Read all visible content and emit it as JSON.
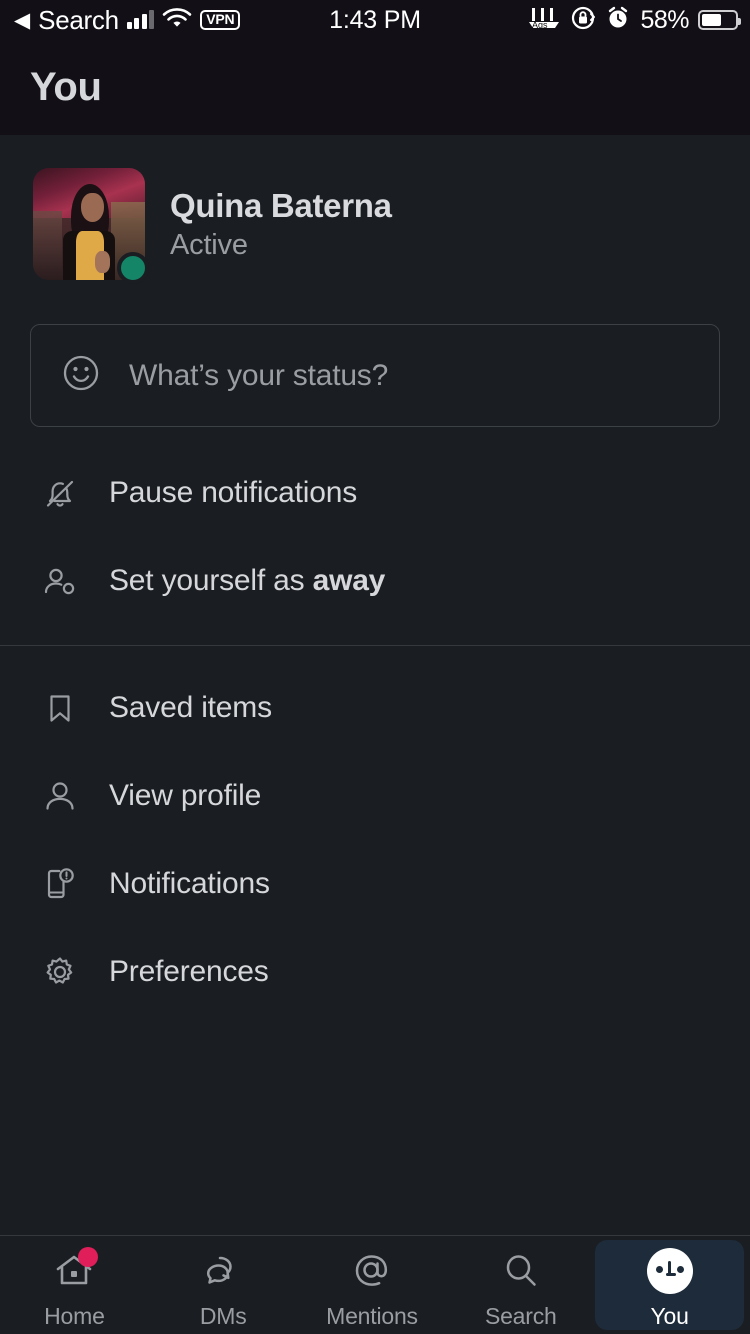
{
  "status_bar": {
    "back_label": "Search",
    "back_arrow": "◀",
    "vpn_label": "VPN",
    "time": "1:43 PM",
    "battery_percent": "58%",
    "icons": [
      "signal-bars-icon",
      "wifi-icon",
      "vpn-icon",
      "app-indicators-icon",
      "screen-lock-rotation-icon",
      "alarm-icon",
      "battery-icon"
    ]
  },
  "header": {
    "title": "You"
  },
  "profile": {
    "name": "Quina Baterna",
    "presence": "Active",
    "presence_color": "#148567",
    "avatar_name": "user-avatar"
  },
  "status_input": {
    "placeholder": "What’s your status?",
    "emoji_icon": "smiley-icon"
  },
  "menu_groups": [
    {
      "items": [
        {
          "icon": "bell-slash-icon",
          "label": "Pause notifications",
          "bold_suffix": ""
        },
        {
          "icon": "person-away-icon",
          "label": "Set yourself as ",
          "bold_suffix": "away"
        }
      ]
    },
    {
      "items": [
        {
          "icon": "bookmark-icon",
          "label": "Saved items",
          "bold_suffix": ""
        },
        {
          "icon": "person-icon",
          "label": "View profile",
          "bold_suffix": ""
        },
        {
          "icon": "phone-notification-icon",
          "label": "Notifications",
          "bold_suffix": ""
        },
        {
          "icon": "gear-icon",
          "label": "Preferences",
          "bold_suffix": ""
        }
      ]
    }
  ],
  "tab_bar": {
    "badge_color": "#e01e5a",
    "active_bg": "#1d2b3a",
    "tabs": [
      {
        "icon": "home-icon",
        "label": "Home",
        "badge": true,
        "active": false
      },
      {
        "icon": "speech-bubbles-icon",
        "label": "DMs",
        "badge": false,
        "active": false
      },
      {
        "icon": "at-sign-icon",
        "label": "Mentions",
        "badge": false,
        "active": false
      },
      {
        "icon": "magnifier-icon",
        "label": "Search",
        "badge": false,
        "active": false
      },
      {
        "icon": "you-avatar-icon",
        "label": "You",
        "badge": false,
        "active": true
      }
    ]
  }
}
